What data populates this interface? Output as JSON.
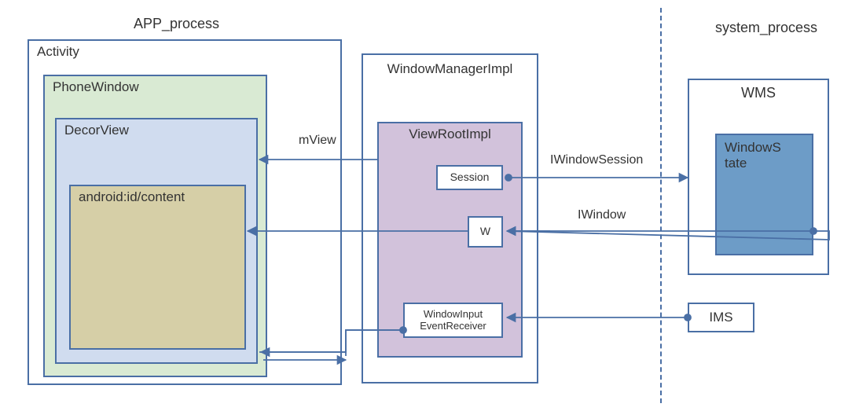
{
  "sections": {
    "app_process": "APP_process",
    "system_process": "system_process"
  },
  "boxes": {
    "activity": "Activity",
    "phone_window": "PhoneWindow",
    "decor_view": "DecorView",
    "content": "android:id/content",
    "window_manager_impl": "WindowManagerImpl",
    "view_root_impl": "ViewRootImpl",
    "session": "Session",
    "w": "W",
    "window_input_event_receiver": "WindowInput\nEventReceiver",
    "wms": "WMS",
    "window_state": "WindowS\ntate",
    "ims": "IMS"
  },
  "connectors": {
    "mview": "mView",
    "iwindow_session": "IWindowSession",
    "iwindow": "IWindow"
  },
  "colors": {
    "border": "#4a6fa5",
    "green": "#d9ead3",
    "blue": "#d0dcef",
    "tan": "#d6cfa7",
    "purple": "#d2c2db",
    "steel": "#6d9cc7"
  }
}
